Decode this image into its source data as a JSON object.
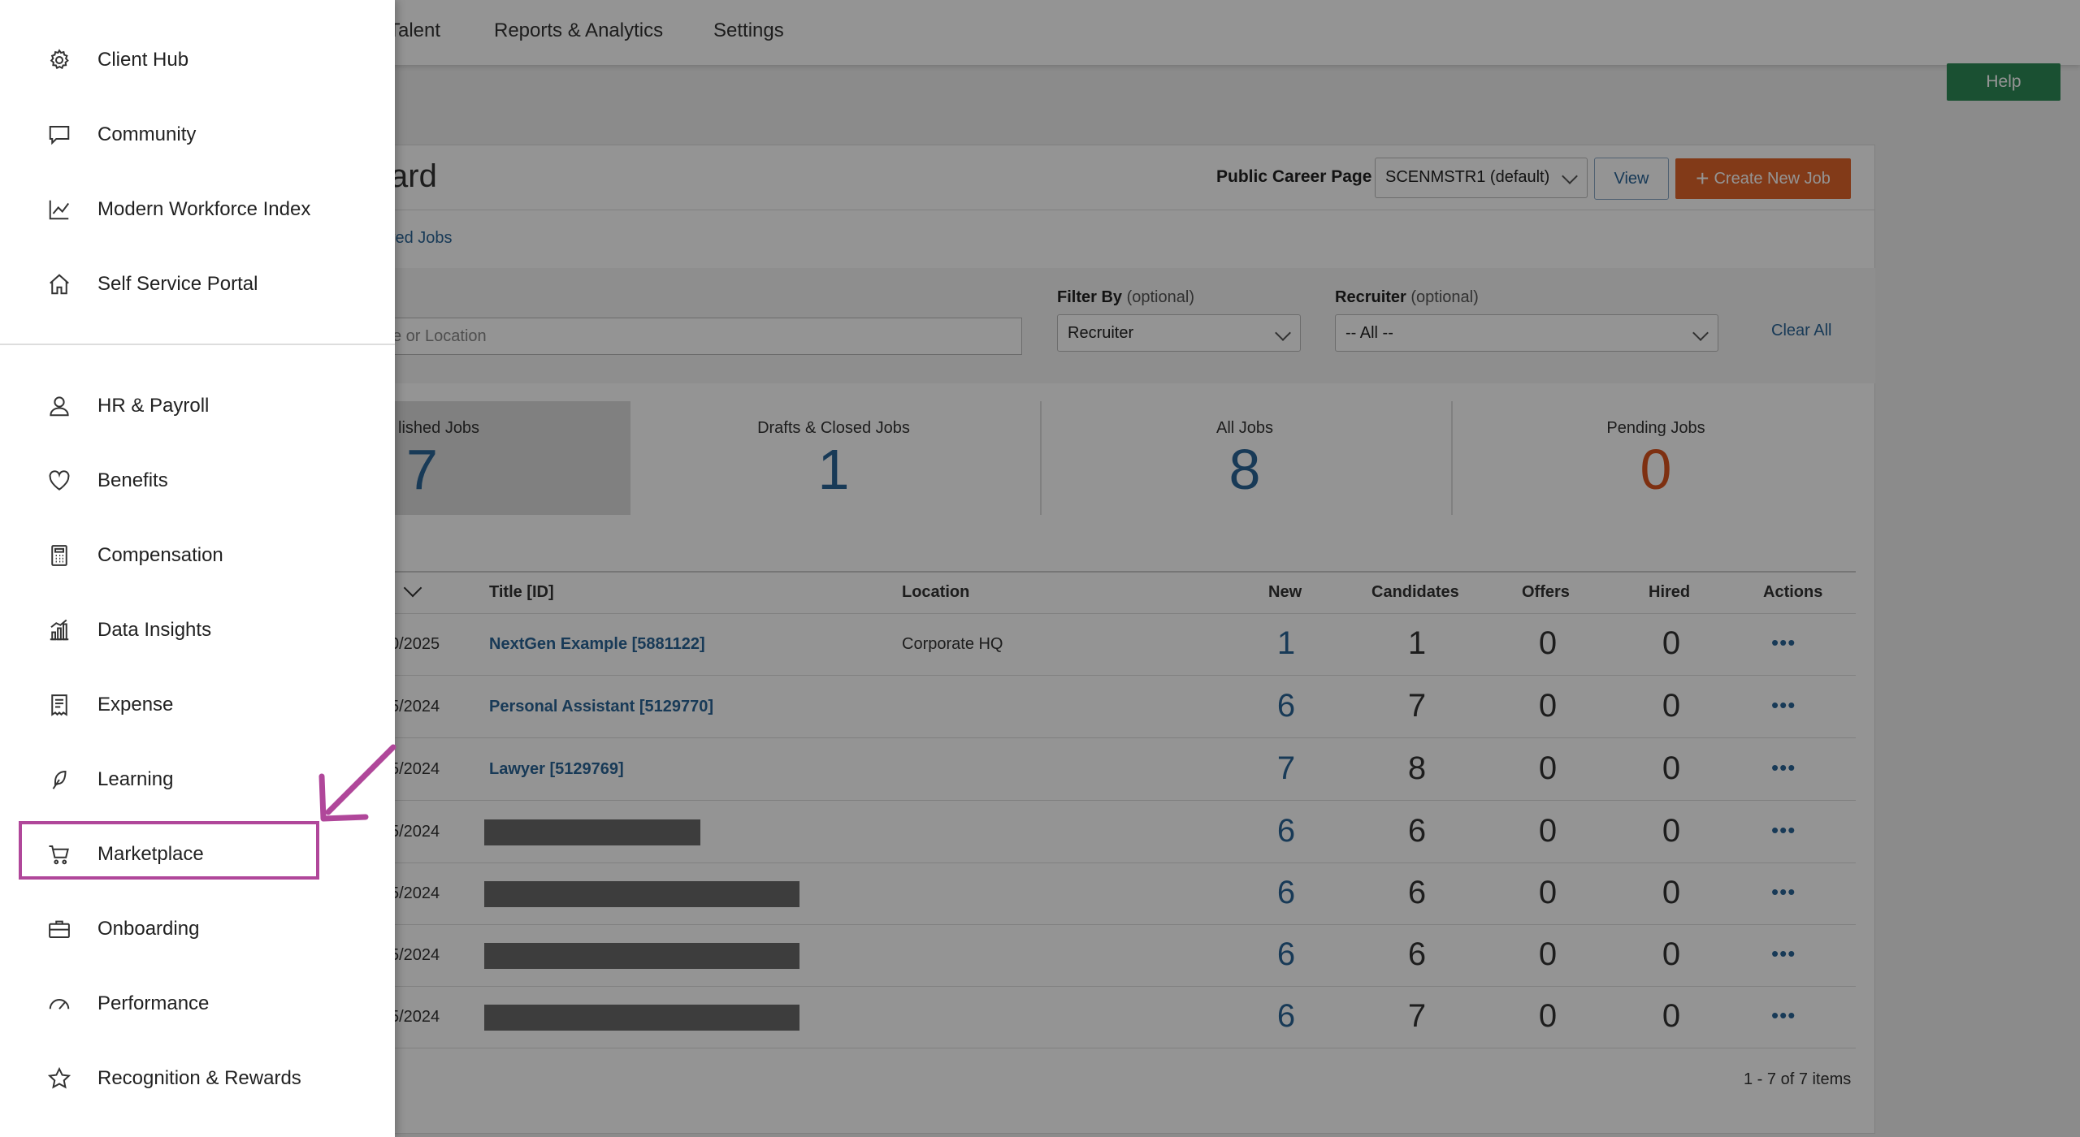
{
  "topnav": [
    "Talent",
    "Reports & Analytics",
    "Settings"
  ],
  "help_label": "Help",
  "dashboard_title": "ard",
  "career_page": {
    "label": "Public Career Page",
    "selected": "SCENMSTR1 (default)",
    "view_label": "View",
    "create_label": "Create New Job"
  },
  "subtab": "ived Jobs",
  "filters": {
    "search_placeholder": "e or Location",
    "filter_by_label": "Filter By",
    "filter_by_optional": "(optional)",
    "filter_by_value": "Recruiter",
    "recruiter_label": "Recruiter",
    "recruiter_optional": "(optional)",
    "recruiter_value": "-- All --",
    "clear_all": "Clear All"
  },
  "stats": [
    {
      "label": "lished Jobs",
      "value": "7"
    },
    {
      "label": "Drafts & Closed Jobs",
      "value": "1"
    },
    {
      "label": "All Jobs",
      "value": "8"
    },
    {
      "label": "Pending Jobs",
      "value": "0"
    }
  ],
  "table": {
    "headers": [
      "Title [ID]",
      "Location",
      "New",
      "Candidates",
      "Offers",
      "Hired",
      "Actions"
    ],
    "rows": [
      {
        "date": "0/2025",
        "title": "NextGen Example [5881122]",
        "location": "Corporate HQ",
        "new": "1",
        "candidates": "1",
        "offers": "0",
        "hired": "0",
        "actions": "•••"
      },
      {
        "date": "5/2024",
        "title": "Personal Assistant [5129770]",
        "location": "",
        "new": "6",
        "candidates": "7",
        "offers": "0",
        "hired": "0",
        "actions": "•••"
      },
      {
        "date": "5/2024",
        "title": "Lawyer [5129769]",
        "location": "",
        "new": "7",
        "candidates": "8",
        "offers": "0",
        "hired": "0",
        "actions": "•••"
      },
      {
        "date": "5/2024",
        "title": "",
        "location": "",
        "new": "6",
        "candidates": "6",
        "offers": "0",
        "hired": "0",
        "actions": "•••"
      },
      {
        "date": "5/2024",
        "title": "",
        "location": "",
        "new": "6",
        "candidates": "6",
        "offers": "0",
        "hired": "0",
        "actions": "•••"
      },
      {
        "date": "5/2024",
        "title": "",
        "location": "",
        "new": "6",
        "candidates": "6",
        "offers": "0",
        "hired": "0",
        "actions": "•••"
      },
      {
        "date": "5/2024",
        "title": "",
        "location": "",
        "new": "6",
        "candidates": "7",
        "offers": "0",
        "hired": "0",
        "actions": "•••"
      }
    ],
    "pager": "1 - 7 of 7 items"
  },
  "drawer": {
    "top_items": [
      {
        "label": "Client Hub",
        "icon": "gear-icon"
      },
      {
        "label": "Community",
        "icon": "chat-icon"
      },
      {
        "label": "Modern Workforce Index",
        "icon": "line-chart-icon"
      },
      {
        "label": "Self Service Portal",
        "icon": "home-icon"
      }
    ],
    "items": [
      {
        "label": "HR & Payroll",
        "icon": "person-icon"
      },
      {
        "label": "Benefits",
        "icon": "heart-icon"
      },
      {
        "label": "Compensation",
        "icon": "calculator-icon"
      },
      {
        "label": "Data Insights",
        "icon": "bar-chart-icon"
      },
      {
        "label": "Expense",
        "icon": "receipt-icon"
      },
      {
        "label": "Learning",
        "icon": "feather-icon"
      },
      {
        "label": "Marketplace",
        "icon": "cart-icon"
      },
      {
        "label": "Onboarding",
        "icon": "briefcase-icon"
      },
      {
        "label": "Performance",
        "icon": "gauge-icon"
      },
      {
        "label": "Recognition & Rewards",
        "icon": "star-icon"
      }
    ]
  },
  "colors": {
    "accent_blue": "#2a6496",
    "orange": "#e0642a",
    "highlight": "#b0479a",
    "help_green": "#2e8b57"
  }
}
